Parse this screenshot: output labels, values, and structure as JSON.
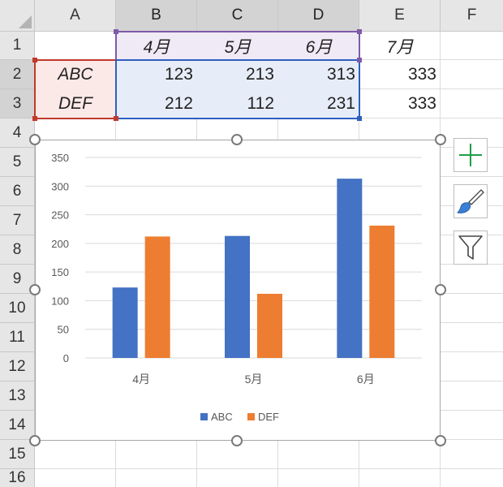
{
  "spreadsheet": {
    "columns": [
      "A",
      "B",
      "C",
      "D",
      "E",
      "F"
    ],
    "rows": [
      "1",
      "2",
      "3",
      "4",
      "5",
      "6",
      "7",
      "8",
      "9",
      "10",
      "11",
      "12",
      "13",
      "14",
      "15",
      "16"
    ],
    "cells": {
      "B1": "4月",
      "C1": "5月",
      "D1": "6月",
      "E1": "7月",
      "A2": "ABC",
      "B2": "123",
      "C2": "213",
      "D2": "313",
      "E2": "333",
      "A3": "DEF",
      "B3": "212",
      "C3": "112",
      "D3": "231",
      "E3": "333"
    }
  },
  "chart_data": {
    "type": "bar",
    "categories": [
      "4月",
      "5月",
      "6月"
    ],
    "series": [
      {
        "name": "ABC",
        "values": [
          123,
          213,
          313
        ],
        "color": "#4472C4"
      },
      {
        "name": "DEF",
        "values": [
          212,
          112,
          231
        ],
        "color": "#ED7D31"
      }
    ],
    "yticks": [
      "0",
      "50",
      "100",
      "150",
      "200",
      "250",
      "300",
      "350"
    ],
    "ylim": [
      0,
      350
    ],
    "grid": true,
    "legend_position": "bottom"
  },
  "chart_tools": {
    "icons": [
      "plus-icon",
      "paintbrush-icon",
      "filter-icon"
    ],
    "colors": {
      "plus": "#1e9e4a",
      "brush": "#3a7fd5"
    }
  },
  "colors": {
    "grid": "#dcdcdc",
    "selection_purple": "#7f5aa8",
    "selection_red": "#c0392b",
    "selection_blue": "#2f5fbf",
    "fill_purple": "#efeaf6",
    "fill_red": "#fbe9e7",
    "fill_blue": "#e7edf8"
  }
}
